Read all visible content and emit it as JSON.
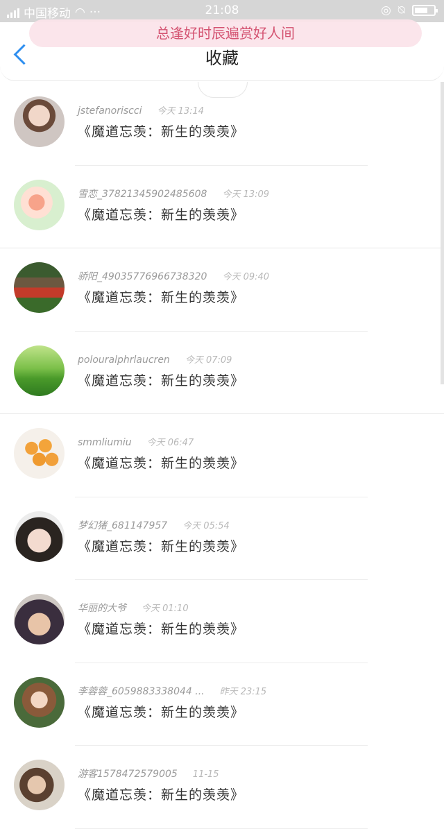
{
  "status_bar": {
    "carrier": "中国移动",
    "time": "21:08"
  },
  "header": {
    "title": "收藏",
    "banner": "总逢好时辰遍赏好人间"
  },
  "items": [
    {
      "name": "jstefanoriscci",
      "time": "今天 13:14",
      "text": "《魔道忘羡：新生的羡羡》"
    },
    {
      "name": "雪恋_37821345902485608",
      "time": "今天 13:09",
      "text": "《魔道忘羡：新生的羡羡》"
    },
    {
      "name": "骄阳_49035776966738320",
      "time": "今天 09:40",
      "text": "《魔道忘羡：新生的羡羡》"
    },
    {
      "name": "polouralphrlaucren",
      "time": "今天 07:09",
      "text": "《魔道忘羡：新生的羡羡》"
    },
    {
      "name": "smmliumiu",
      "time": "今天 06:47",
      "text": "《魔道忘羡：新生的羡羡》"
    },
    {
      "name": "梦幻猪_681147957",
      "time": "今天 05:54",
      "text": "《魔道忘羡：新生的羡羡》"
    },
    {
      "name": "华丽的大爷",
      "time": "今天 01:10",
      "text": "《魔道忘羡：新生的羡羡》"
    },
    {
      "name": "李蓉蓉_6059883338044 ...",
      "time": "昨天 23:15",
      "text": "《魔道忘羡：新生的羡羡》"
    },
    {
      "name": "游客1578472579005",
      "time": "11-15",
      "text": "《魔道忘羡：新生的羡羡》"
    }
  ]
}
